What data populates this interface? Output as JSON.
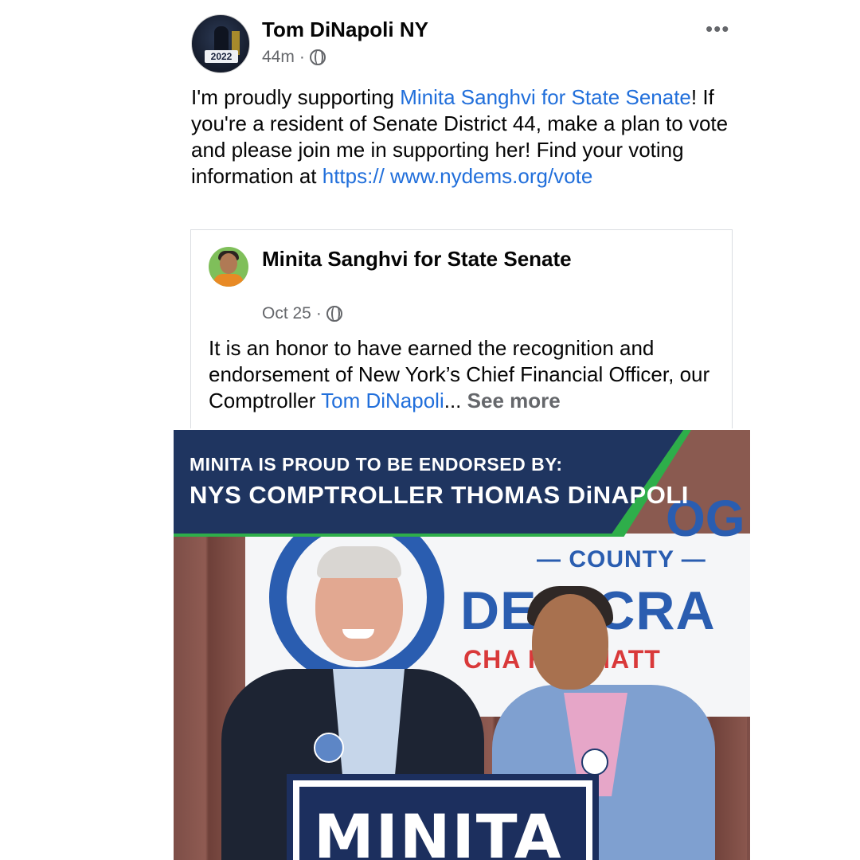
{
  "post": {
    "author": "Tom DiNapoli NY",
    "avatar_badge": "2022",
    "time": "44m",
    "dot": "·",
    "more_glyph": "•••",
    "text_parts": {
      "p1": "I'm proudly supporting ",
      "link1": "Minita Sanghvi for State Senate",
      "p2": "! If you're a resident of Senate District 44, make a plan to vote and please join me in supporting her! Find your voting information at ",
      "link2": "https:// www.nydems.org/vote"
    }
  },
  "shared_post": {
    "author": "Minita Sanghvi for State Senate",
    "date": "Oct 25",
    "dot": "·",
    "text_parts": {
      "p1": "It is an honor to have earned the recognition and endorsement of New York’s Chief Financial Officer, our Comptroller ",
      "link": "Tom DiNapoli",
      "ellipsis": "...",
      "see_more": "See more"
    }
  },
  "photo": {
    "header_line1": "MINITA IS PROUD TO BE ENDORSED BY:",
    "header_line2": "NYS COMPTROLLER THOMAS DiNAPOLI",
    "banner_og": "OG",
    "banner_county": "— COUNTY —",
    "banner_dem": "DE  OCRA",
    "banner_tag": "CHA  HAT MATT",
    "sign_text": "MINITA"
  },
  "colors": {
    "link": "#216fdb",
    "header_navy": "#1f3560",
    "header_green": "#2eae4a"
  }
}
